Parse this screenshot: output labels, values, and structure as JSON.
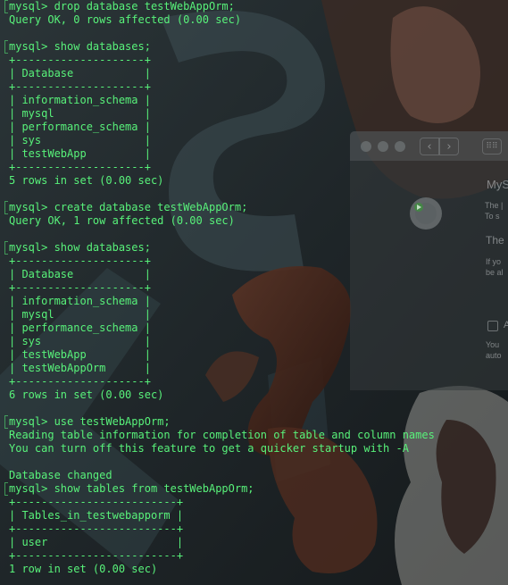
{
  "terminal": {
    "colors": {
      "text": "#58f27a",
      "background": "#1d2326"
    },
    "lines": [
      "mysql> drop database testWebAppOrm;",
      "Query OK, 0 rows affected (0.00 sec)",
      "",
      "mysql> show databases;",
      "+--------------------+",
      "| Database           |",
      "+--------------------+",
      "| information_schema |",
      "| mysql              |",
      "| performance_schema |",
      "| sys                |",
      "| testWebApp         |",
      "+--------------------+",
      "5 rows in set (0.00 sec)",
      "",
      "mysql> create database testWebAppOrm;",
      "Query OK, 1 row affected (0.00 sec)",
      "",
      "mysql> show databases;",
      "+--------------------+",
      "| Database           |",
      "+--------------------+",
      "| information_schema |",
      "| mysql              |",
      "| performance_schema |",
      "| sys                |",
      "| testWebApp         |",
      "| testWebAppOrm      |",
      "+--------------------+",
      "6 rows in set (0.00 sec)",
      "",
      "mysql> use testWebAppOrm;",
      "Reading table information for completion of table and column names",
      "You can turn off this feature to get a quicker startup with -A",
      "",
      "Database changed",
      "mysql> show tables from testWebAppOrm;",
      "+-------------------------+",
      "| Tables_in_testwebapporm |",
      "+-------------------------+",
      "| user                    |",
      "+-------------------------+",
      "1 row in set (0.00 sec)"
    ]
  },
  "preferences_window": {
    "back_icon": "chevron-left-icon",
    "forward_icon": "chevron-right-icon",
    "grid_icon": "grid-icon",
    "title": "MyS",
    "line1": "The |",
    "line2": "To s",
    "heading2": "The",
    "line3": "If yo",
    "line4": "be al",
    "checkbox_label": "A",
    "line5": "You",
    "line6": "auto"
  }
}
